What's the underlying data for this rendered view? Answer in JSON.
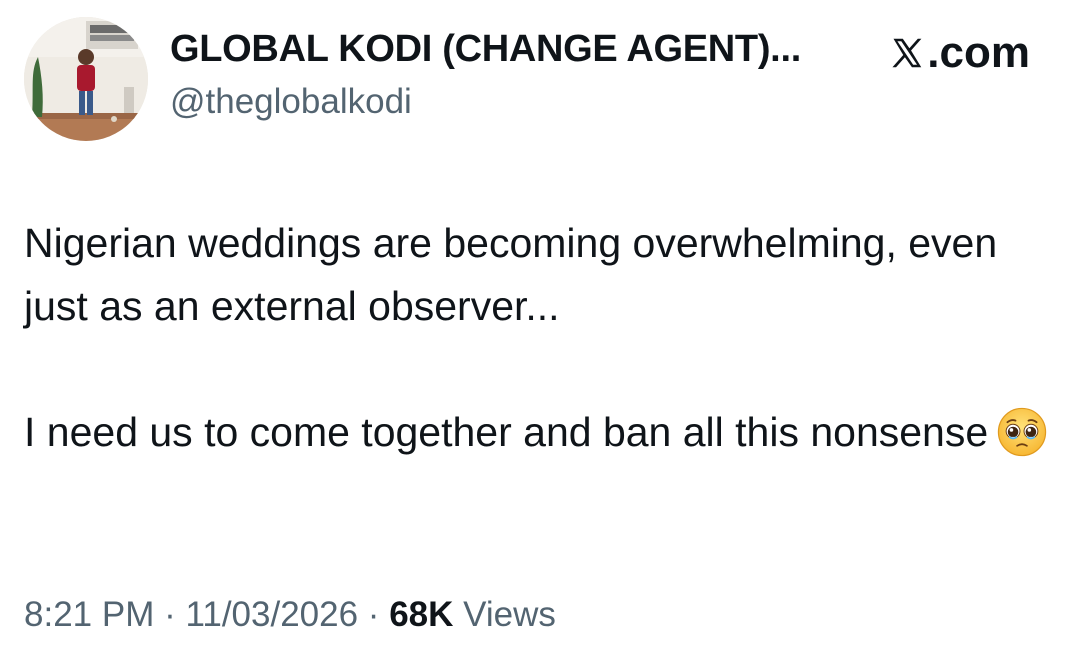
{
  "author": {
    "display_name": "GLOBAL KODI (CHANGE AGENT)...",
    "handle": "@theglobalkodi",
    "avatar_icon": "profile-photo"
  },
  "platform": {
    "logo_icon": "x-logo-icon",
    "label": ".com"
  },
  "tweet": {
    "paragraph_1": "Nigerian weddings are becoming overwhelming, even just as an external observer...",
    "paragraph_2": "I need us to come together and ban all this nonsense",
    "emoji_icon": "pleading-face-emoji"
  },
  "meta": {
    "time": "8:21 PM",
    "separator": "·",
    "date": "11/03/2026",
    "views_count": "68K",
    "views_label": "Views"
  },
  "colors": {
    "text_primary": "#0f1419",
    "text_secondary": "#536471",
    "background": "#ffffff"
  }
}
